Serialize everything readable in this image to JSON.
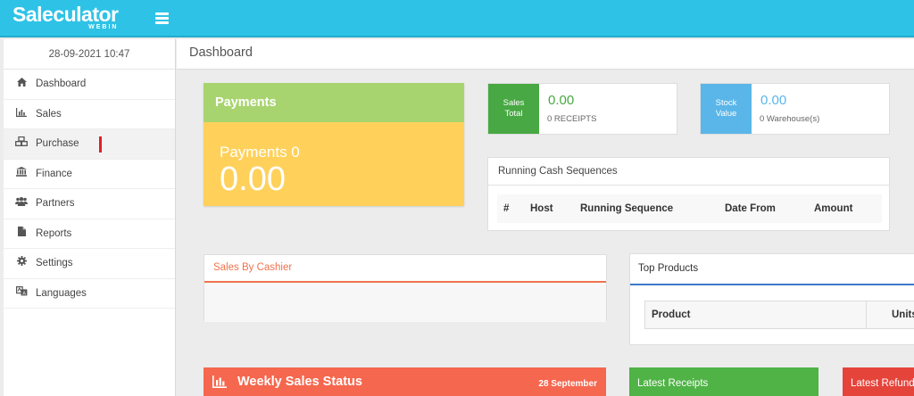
{
  "header": {
    "logo_main": "Saleculator",
    "logo_sub": "WEBIN"
  },
  "sidebar": {
    "datetime": "28-09-2021 10:47",
    "items": [
      {
        "label": "Dashboard",
        "icon": "home-icon"
      },
      {
        "label": "Sales",
        "icon": "bar-chart-icon"
      },
      {
        "label": "Purchase",
        "icon": "cubes-icon"
      },
      {
        "label": "Finance",
        "icon": "bank-icon"
      },
      {
        "label": "Partners",
        "icon": "users-icon"
      },
      {
        "label": "Reports",
        "icon": "file-icon"
      },
      {
        "label": "Settings",
        "icon": "gear-icon"
      },
      {
        "label": "Languages",
        "icon": "language-icon"
      }
    ]
  },
  "page": {
    "title": "Dashboard"
  },
  "payments": {
    "title": "Payments",
    "label": "Payments 0",
    "value": "0.00",
    "head_color": "#a8d46f",
    "body_color": "#ffd15b"
  },
  "sales_total": {
    "label_line1": "Sales",
    "label_line2": "Total",
    "value": "0.00",
    "sub": "0 RECEIPTS",
    "color": "#48a843"
  },
  "stock_value": {
    "label_line1": "Stock",
    "label_line2": "Value",
    "value": "0.00",
    "sub": "0 Warehouse(s)",
    "color": "#5ab6e8"
  },
  "running_cash": {
    "title": "Running Cash Sequences",
    "columns": [
      "#",
      "Host",
      "Running Sequence",
      "Date From",
      "Amount"
    ]
  },
  "sales_by_cashier": {
    "title": "Sales By Cashier",
    "color": "#f0734d"
  },
  "top_products": {
    "title": "Top Products",
    "columns": [
      "Product",
      "Units"
    ],
    "color": "#3f7ac8"
  },
  "weekly_sales": {
    "title": "Weekly Sales Status",
    "date": "28 September",
    "color": "#f5674e"
  },
  "latest_receipts": {
    "title": "Latest Receipts",
    "color": "#4fb346"
  },
  "latest_refunds": {
    "title": "Latest Refunds",
    "color": "#e5443b"
  }
}
